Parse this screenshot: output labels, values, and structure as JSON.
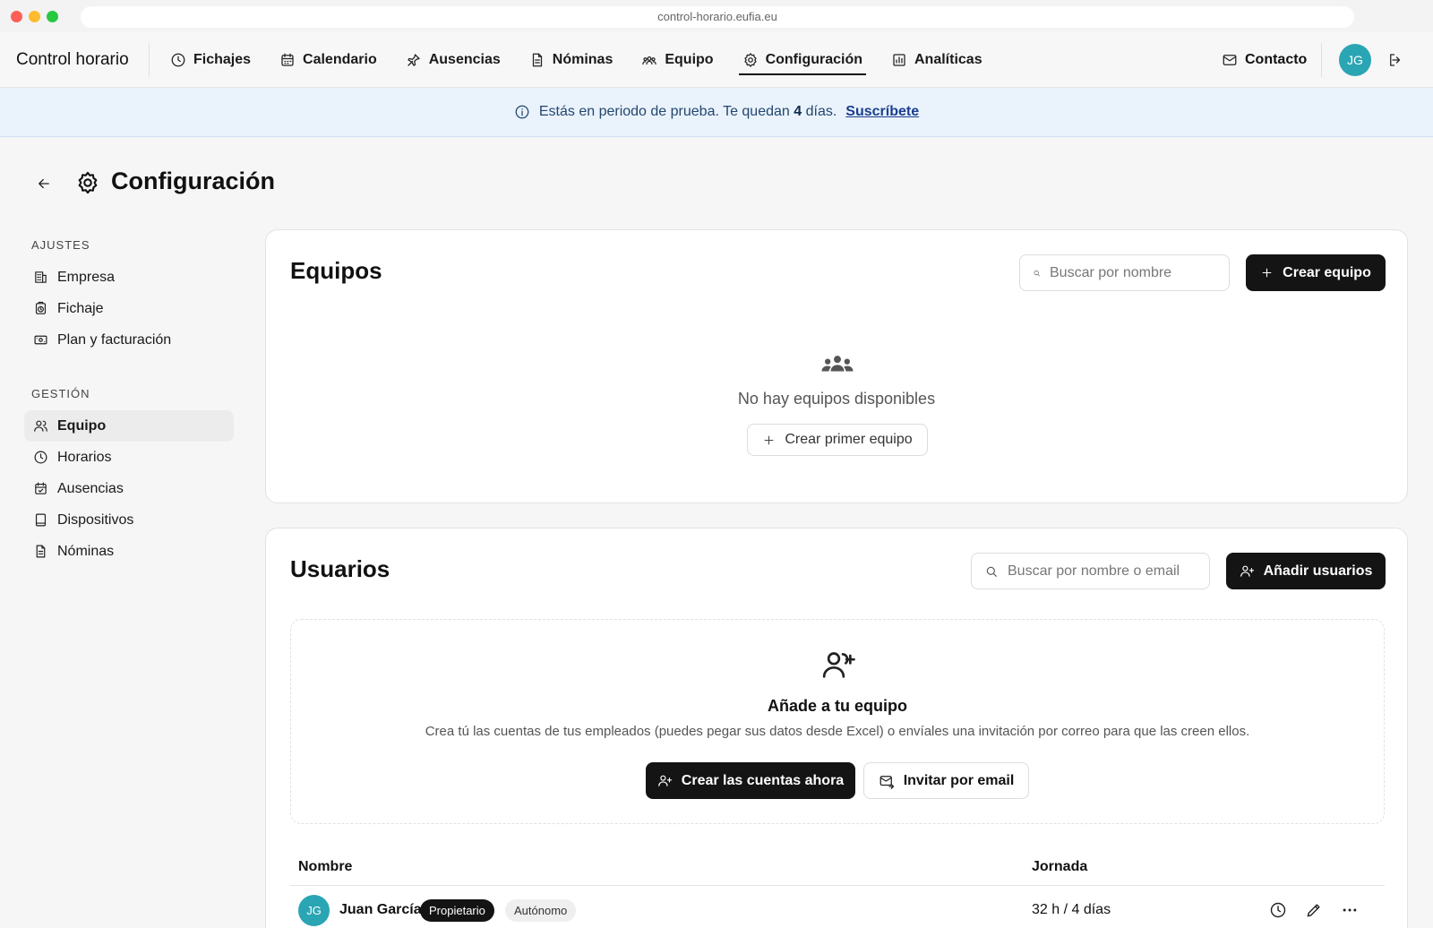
{
  "browser": {
    "url": "control-horario.eufia.eu"
  },
  "nav": {
    "brand": "Control horario",
    "items": [
      {
        "label": "Fichajes",
        "icon": "clock-icon"
      },
      {
        "label": "Calendario",
        "icon": "calendar-icon"
      },
      {
        "label": "Ausencias",
        "icon": "plane-icon"
      },
      {
        "label": "Nóminas",
        "icon": "document-icon"
      },
      {
        "label": "Equipo",
        "icon": "users-icon"
      },
      {
        "label": "Configuración",
        "icon": "gear-icon",
        "active": true
      },
      {
        "label": "Analíticas",
        "icon": "chart-icon"
      }
    ],
    "contact": "Contacto",
    "avatar": "JG"
  },
  "banner": {
    "text_before": "Estás en periodo de prueba. Te quedan",
    "days": "4",
    "text_after": "días.",
    "link": "Suscríbete"
  },
  "page": {
    "title": "Configuración"
  },
  "sidebar": {
    "ajustes_heading": "AJUSTES",
    "ajustes": [
      {
        "label": "Empresa",
        "icon": "building-icon"
      },
      {
        "label": "Fichaje",
        "icon": "stopwatch-icon"
      },
      {
        "label": "Plan y facturación",
        "icon": "money-icon"
      }
    ],
    "gestion_heading": "GESTIÓN",
    "gestion": [
      {
        "label": "Equipo",
        "icon": "users-icon",
        "active": true
      },
      {
        "label": "Horarios",
        "icon": "clock-icon"
      },
      {
        "label": "Ausencias",
        "icon": "calendar-check-icon"
      },
      {
        "label": "Dispositivos",
        "icon": "tablet-icon"
      },
      {
        "label": "Nóminas",
        "icon": "document-icon"
      }
    ]
  },
  "teams": {
    "title": "Equipos",
    "search_placeholder": "Buscar por nombre",
    "create_label": "Crear equipo",
    "empty_text": "No hay equipos disponibles",
    "first_label": "Crear primer equipo"
  },
  "users": {
    "title": "Usuarios",
    "search_placeholder": "Buscar por nombre o email",
    "add_label": "Añadir usuarios",
    "invite_title": "Añade a tu equipo",
    "invite_desc": "Crea tú las cuentas de tus empleados (puedes pegar sus datos desde Excel) o envíales una invitación por correo para que las creen ellos.",
    "create_accounts_label": "Crear las cuentas ahora",
    "invite_email_label": "Invitar por email",
    "columns": {
      "name": "Nombre",
      "jornada": "Jornada"
    },
    "rows": [
      {
        "initials": "JG",
        "name": "Juan García",
        "role": "Propietario",
        "type": "Autónomo",
        "jornada": "32 h / 4 días"
      }
    ]
  },
  "colors": {
    "accent": "#141414",
    "avatar": "#2aa5b4",
    "banner_bg": "#eaf3fc",
    "banner_link": "#1b3f8f"
  }
}
